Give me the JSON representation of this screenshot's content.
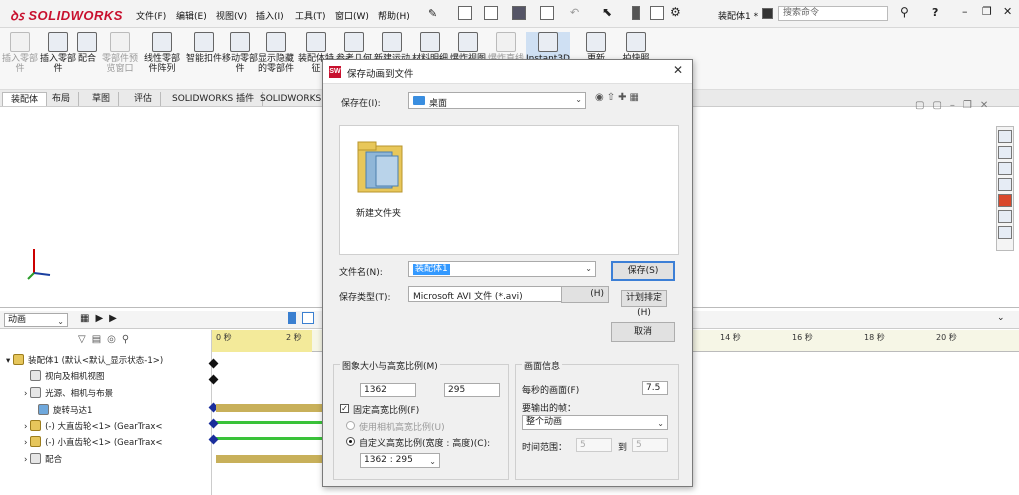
{
  "app": {
    "logo": "SOLIDWORKS",
    "menu": [
      "文件(F)",
      "编辑(E)",
      "视图(V)",
      "插入(I)",
      "工具(T)",
      "窗口(W)",
      "帮助(H)"
    ],
    "doc_title": "装配体1 *",
    "search_placeholder": "搜索命令"
  },
  "ribbon": {
    "buttons": [
      {
        "label": "插入零部件",
        "disabled": true
      },
      {
        "label": "插入零部件",
        "disabled": false
      },
      {
        "label": "配合",
        "disabled": false
      },
      {
        "label": "零部件预览窗口",
        "disabled": true
      },
      {
        "label": "线性零部件阵列",
        "disabled": false
      },
      {
        "label": "智能扣件",
        "disabled": false
      },
      {
        "label": "移动零部件",
        "disabled": false
      },
      {
        "label": "显示隐藏的零部件",
        "disabled": false
      },
      {
        "label": "装配体特征",
        "disabled": false
      },
      {
        "label": "参考几何体",
        "disabled": false
      },
      {
        "label": "新建运动算例",
        "disabled": false
      },
      {
        "label": "材料明细表",
        "disabled": false
      },
      {
        "label": "爆炸视图",
        "disabled": false
      },
      {
        "label": "爆炸直线草图",
        "disabled": true
      },
      {
        "label": "Instant3D",
        "disabled": false
      },
      {
        "label": "更新",
        "disabled": false
      },
      {
        "label": "拍快照",
        "disabled": false
      }
    ]
  },
  "tabs": [
    "装配体",
    "布局",
    "草图",
    "评估",
    "SOLIDWORKS 插件",
    "SOLIDWORKS M"
  ],
  "motion": {
    "study_type": "动画",
    "ruler_ticks": [
      "0 秒",
      "2 秒",
      "14 秒",
      "16 秒",
      "18 秒",
      "20 秒"
    ],
    "tree": [
      {
        "label": "装配体1 (默认<默认_显示状态-1>)"
      },
      {
        "label": "视向及相机视图"
      },
      {
        "label": "光源、相机与布景"
      },
      {
        "label": "旋转马达1"
      },
      {
        "label": "(-) 大直齿轮<1> (GearTrax<"
      },
      {
        "label": "(-) 小直齿轮<1> (GearTrax<"
      },
      {
        "label": "配合"
      }
    ]
  },
  "dialog": {
    "title": "保存动画到文件",
    "save_in_label": "保存在(I):",
    "save_in_value": "桌面",
    "folder_name": "新建文件夹",
    "file_name_label": "文件名(N):",
    "file_name_value": "装配体1",
    "file_type_label": "保存类型(T):",
    "file_type_value": "Microsoft AVI 文件 (*.avi)",
    "save_button": "保存(S)",
    "help_button": "(H)",
    "schedule_button": "计划排定(H)",
    "cancel_button": "取消",
    "image_size_group": "图象大小与高宽比例(M)",
    "width": "1362",
    "height": "295",
    "fixed_aspect_label": "固定高宽比例(F)",
    "use_camera_aspect_label": "使用相机高宽比例(U)",
    "custom_aspect_label": "自定义高宽比例(宽度 : 高度)(C):",
    "custom_aspect_value": "1362 : 295",
    "frame_info_group": "画面信息",
    "fps_label": "每秒的画面(F)",
    "fps_value": "7.5",
    "frames_label": "要输出的帧：",
    "frames_value": "整个动画",
    "time_range_label": "时间范围：",
    "time_from": "5",
    "time_to_label": "到",
    "time_to": "5"
  }
}
